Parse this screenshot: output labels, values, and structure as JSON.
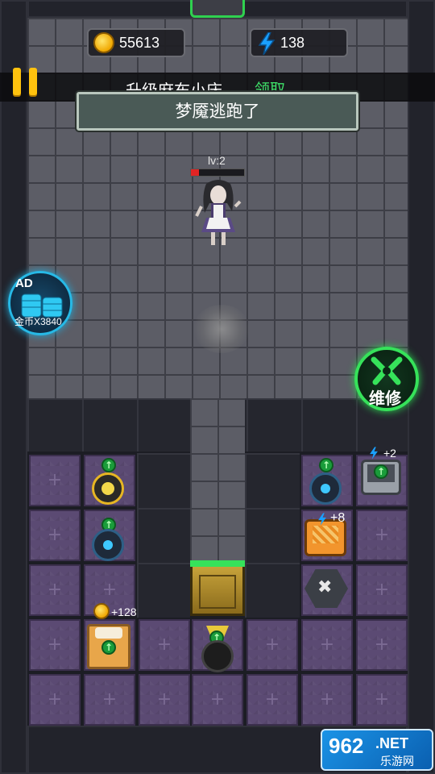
{
  "hud": {
    "coins": "55613",
    "energy": "138"
  },
  "banner": {
    "text": "升级麻布小床",
    "claim": "领取"
  },
  "toast": "梦魇逃跑了",
  "enemy": {
    "level_label": "lv:2",
    "health_fraction": 0.15
  },
  "ad_bonus": {
    "badge": "AD",
    "label": "金币X3840"
  },
  "repair_label": "维修",
  "floating": {
    "energy_gain": "+2",
    "energy_gain_2": "+8",
    "coin_gain": "+128"
  },
  "watermark": {
    "number": "962",
    "suffix": ".NET",
    "site": "乐游网"
  },
  "colors": {
    "gold": "#ffc20e",
    "energy_blue": "#1aa0ff",
    "repair_green": "#36e25a",
    "ad_cyan": "#27b9e6"
  }
}
